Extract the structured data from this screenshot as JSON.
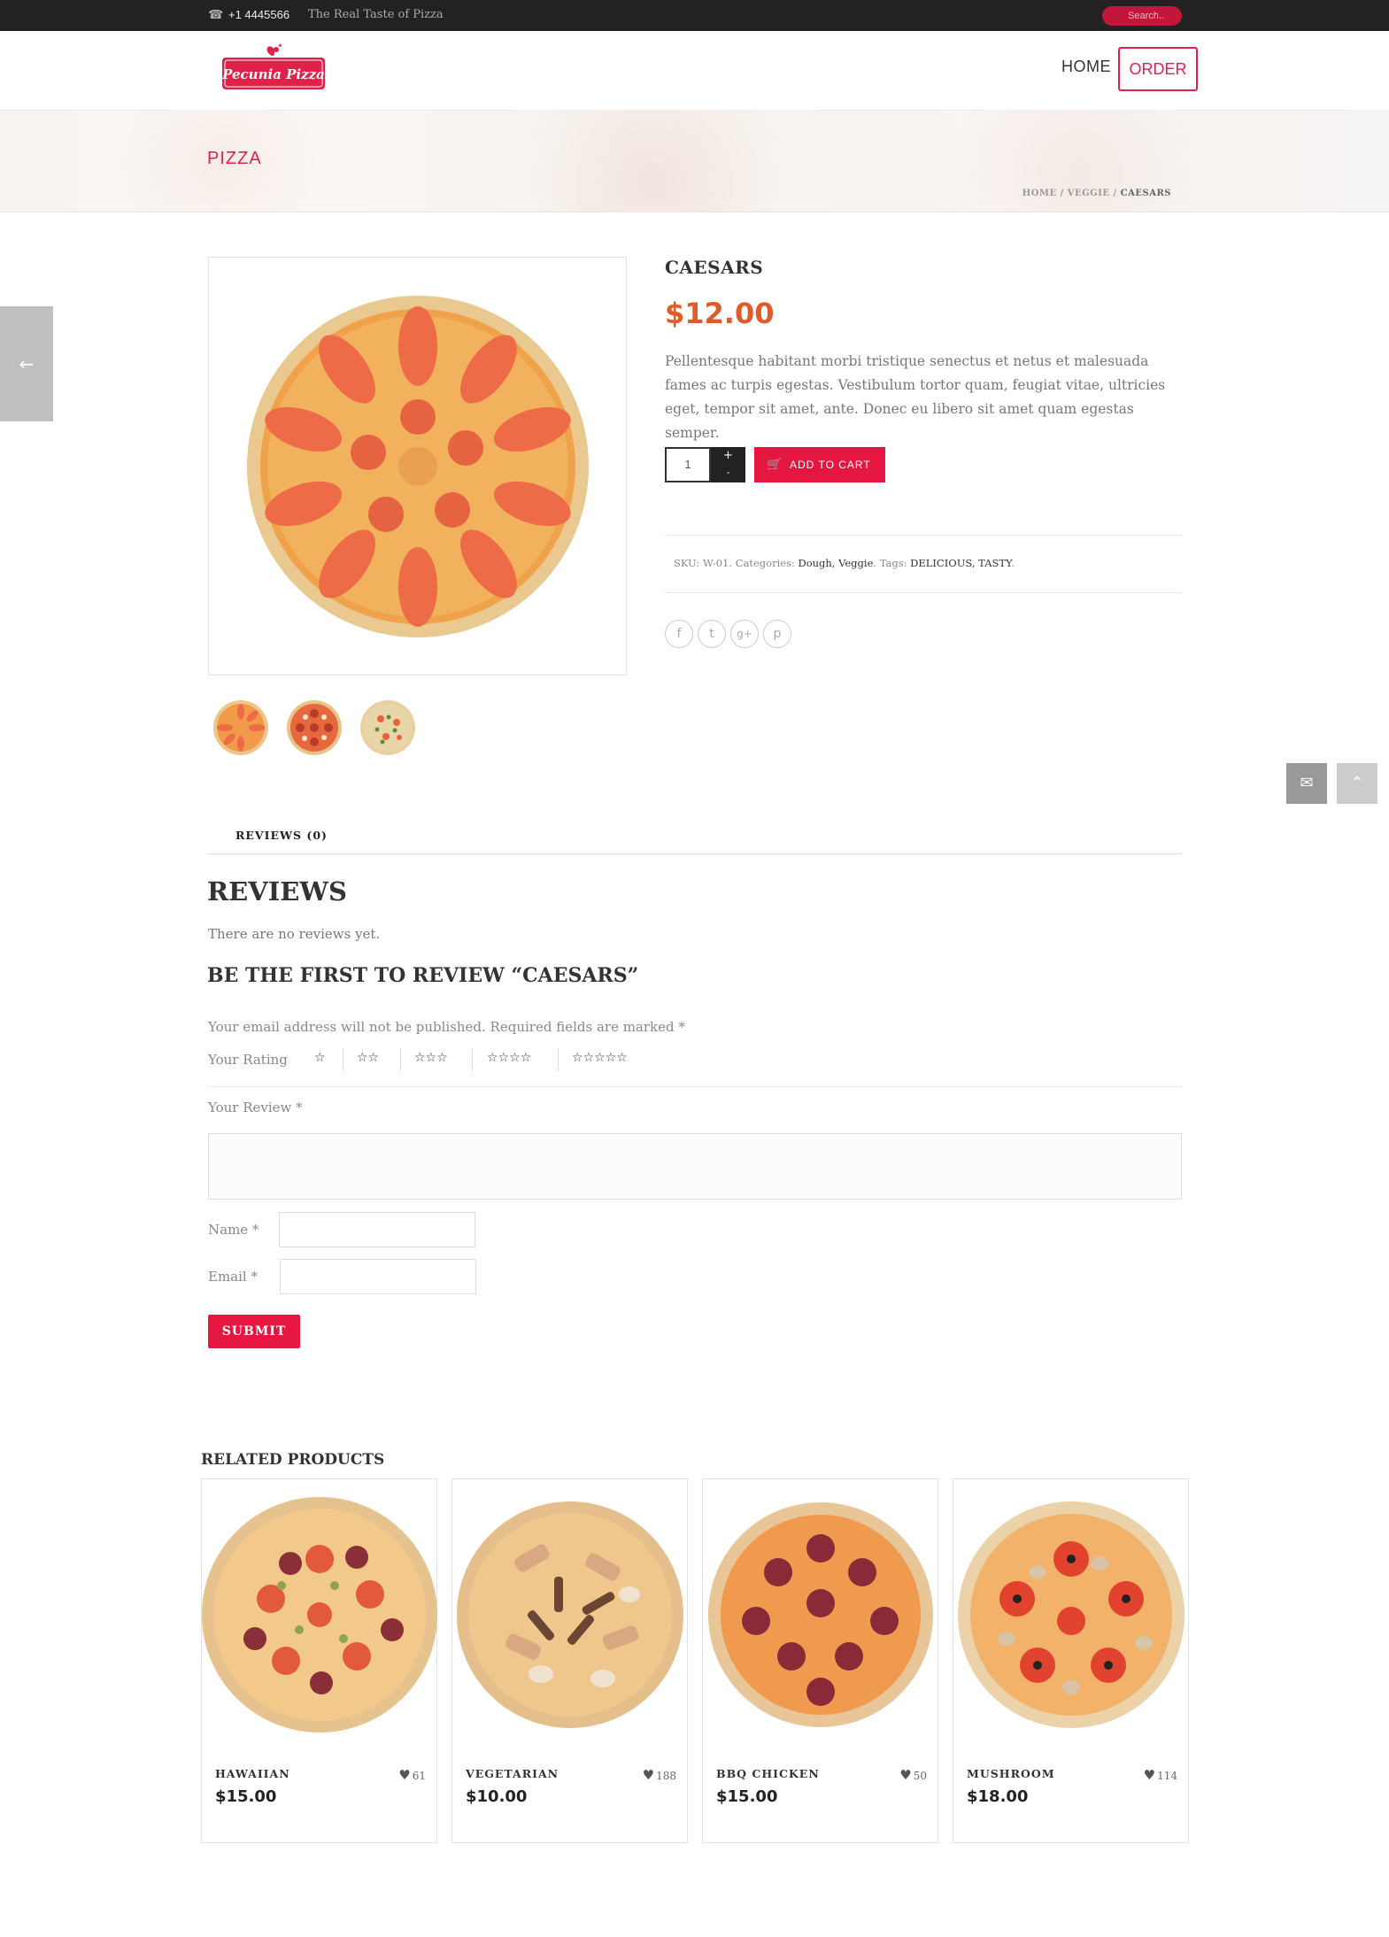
{
  "topbar": {
    "phone": "+1 4445566",
    "tagline": "The Real Taste of Pizza",
    "search_placeholder": "Search..",
    "phone_icon": "phone-icon"
  },
  "header": {
    "logo_text": "Pecunia Pizza",
    "nav": {
      "home": "HOME",
      "order": "ORDER"
    }
  },
  "banner": {
    "title": "PIZZA",
    "breadcrumb": {
      "home": "HOME",
      "sep": "/",
      "category": "VEGGIE",
      "current": "CAESARS"
    }
  },
  "product": {
    "title": "CAESARS",
    "price": "$12.00",
    "description": "Pellentesque habitant morbi tristique senectus et netus et malesuada fames ac turpis egestas. Vestibulum tortor quam, feugiat vitae, ultricies eget, tempor sit amet, ante. Donec eu libero sit amet quam egestas semper.",
    "quantity": "1",
    "qty_plus": "+",
    "qty_minus": "-",
    "add_to_cart": "ADD TO CART",
    "meta": {
      "sku_label": "SKU: ",
      "sku": "W-01",
      "categories_label": ". Categories: ",
      "categories": "Dough, Veggie",
      "tags_label": ". Tags: ",
      "tags": "DELICIOUS, TASTY",
      "end": "."
    },
    "share_icons": [
      "facebook-icon",
      "twitter-icon",
      "google-plus-icon",
      "pinterest-icon"
    ]
  },
  "tabs": {
    "reviews": "REVIEWS (0)"
  },
  "reviews": {
    "heading": "REVIEWS",
    "none": "There are no reviews yet.",
    "first": "BE THE FIRST TO REVIEW “CAESARS”",
    "note": "Your email address will not be published. Required fields are marked *",
    "rating_label": "Your Rating",
    "stars": [
      "☆",
      "☆☆",
      "☆☆☆",
      "☆☆☆☆",
      "☆☆☆☆☆"
    ],
    "review_label": "Your Review *",
    "name_label": "Name *",
    "email_label": "Email *",
    "submit": "SUBMIT"
  },
  "related": {
    "heading": "RELATED PRODUCTS",
    "items": [
      {
        "name": "HAWAIIAN",
        "price": "$15.00",
        "likes": "61"
      },
      {
        "name": "VEGETARIAN",
        "price": "$10.00",
        "likes": "188"
      },
      {
        "name": "BBQ CHICKEN",
        "price": "$15.00",
        "likes": "50"
      },
      {
        "name": "MUSHROOM",
        "price": "$18.00",
        "likes": "114"
      }
    ]
  },
  "colors": {
    "accent": "#e5163f",
    "price": "#e05a2a",
    "topbar": "#222222"
  }
}
